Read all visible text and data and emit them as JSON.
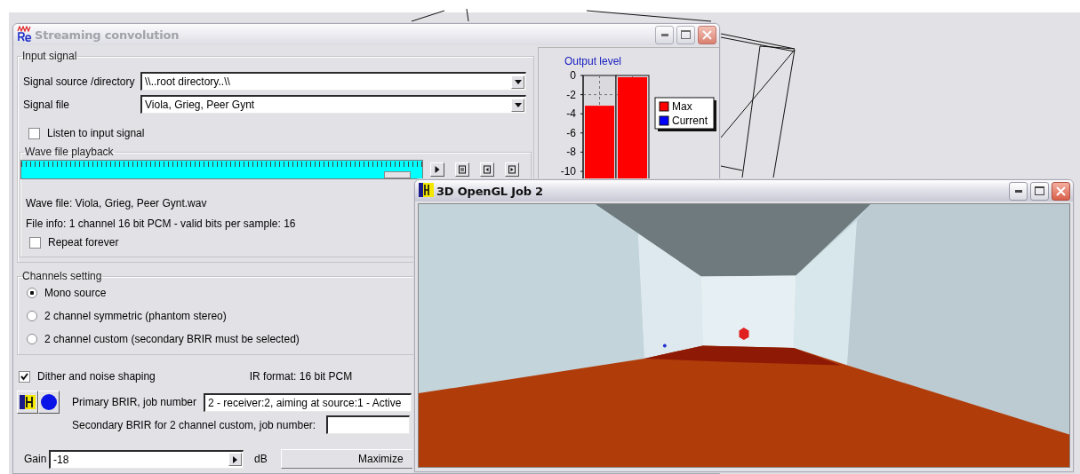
{
  "streaming_window": {
    "title": "Streaming convolution",
    "active": false,
    "input_signal": {
      "title": "Input signal",
      "source": {
        "label": "Signal source /directory",
        "value": "\\\\..root directory..\\\\"
      },
      "file": {
        "label": "Signal file",
        "value": "Viola, Grieg, Peer Gynt"
      },
      "listen": {
        "label": "Listen to input signal",
        "checked": false
      }
    },
    "playback": {
      "title": "Wave file playback",
      "level": 0.97,
      "wave_file": "Wave file: Viola, Grieg, Peer Gynt.wav",
      "file_info": "File info: 1 channel 16 bit PCM - valid bits per sample: 16",
      "repeat": {
        "label": "Repeat forever",
        "checked": false
      }
    },
    "channels": {
      "title": "Channels setting",
      "options": [
        {
          "label": "Mono source",
          "selected": true
        },
        {
          "label": "2 channel symmetric (phantom stereo)",
          "selected": false
        },
        {
          "label": "2 channel custom (secondary BRIR must be selected)",
          "selected": false
        }
      ]
    },
    "dither": {
      "label": "Dither and noise shaping",
      "checked": true
    },
    "ir_format": "IR format: 16 bit PCM",
    "primary": {
      "label": "Primary BRIR, job number",
      "value": "2 - receiver:2, aiming at source:1 - Active"
    },
    "secondary": {
      "label": "Secondary BRIR for 2 channel custom, job number:"
    },
    "gain": {
      "label": "Gain",
      "value": "-18",
      "unit": "dB"
    },
    "maximize": "Maximize",
    "output_level": {
      "title": "Output level",
      "scale": [
        "0",
        "-2",
        "-4",
        "-6",
        "-8",
        "-10"
      ],
      "meters": [
        {
          "level": 0.73,
          "color": "#ff0000"
        },
        {
          "level": 1,
          "color": "#ff0000"
        }
      ],
      "legend": [
        {
          "label": "Max",
          "color": "#ff0000"
        },
        {
          "label": "Current",
          "color": "#0000ff"
        }
      ]
    }
  },
  "opengl_window": {
    "title": "3D OpenGL Job 2",
    "active": true
  }
}
